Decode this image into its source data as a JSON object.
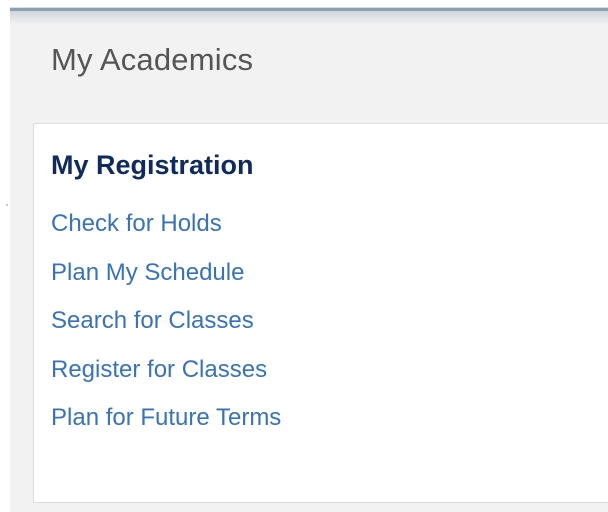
{
  "card": {
    "title": "My Academics"
  },
  "registration": {
    "heading": "My Registration",
    "links": [
      {
        "label": "Check for Holds"
      },
      {
        "label": "Plan My Schedule"
      },
      {
        "label": "Search for Classes"
      },
      {
        "label": "Register for Classes"
      },
      {
        "label": "Plan for Future Terms"
      }
    ]
  },
  "colors": {
    "card_background": "#f2f2f2",
    "heading": "#0f2a5c",
    "link": "#3a73b5",
    "title": "#555555",
    "card_border_top": "#8aa0b4"
  }
}
